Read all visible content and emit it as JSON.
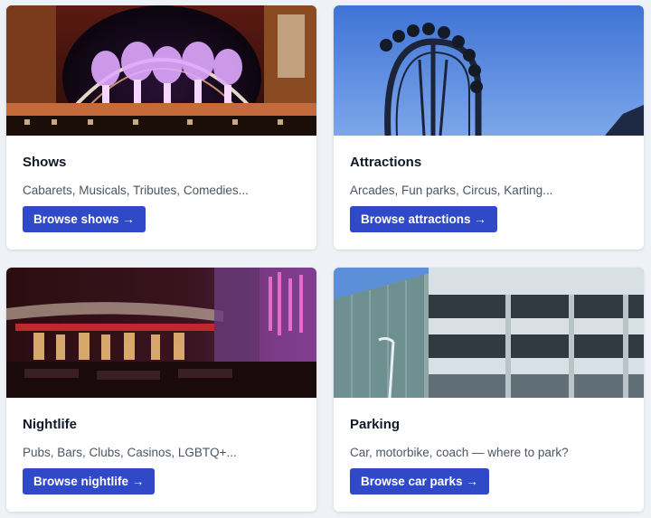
{
  "cards": [
    {
      "title": "Shows",
      "description": "Cabarets, Musicals, Tributes, Comedies...",
      "button": "Browse shows →",
      "image_icon": "stage-photo"
    },
    {
      "title": "Attractions",
      "description": "Arcades, Fun parks, Circus, Karting...",
      "button": "Browse attractions →",
      "image_icon": "rollercoaster-photo"
    },
    {
      "title": "Nightlife",
      "description": "Pubs, Bars, Clubs, Casinos, LGBTQ+...",
      "button": "Browse nightlife →",
      "image_icon": "bar-interior-photo"
    },
    {
      "title": "Parking",
      "description": "Car, motorbike, coach — where to park?",
      "button": "Browse car parks →",
      "image_icon": "car-park-photo"
    }
  ],
  "colors": {
    "accent": "#2f49c9",
    "page_background": "#eef1f5",
    "card_background": "#ffffff",
    "title": "#111827",
    "description": "#4b5563"
  }
}
